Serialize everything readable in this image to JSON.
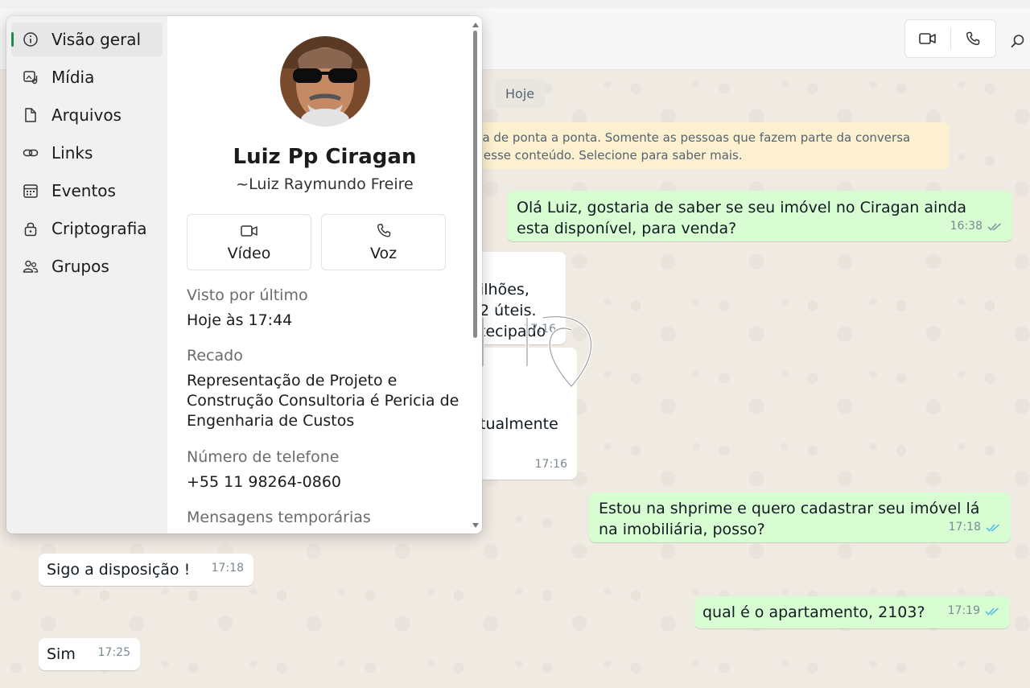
{
  "chat": {
    "date_chip": "Hoje",
    "encryption_notice": "fia de ponta a ponta. Somente as pessoas que fazem parte da conversa\nr esse conteúdo. Selecione para saber mais.",
    "messages": [
      {
        "text": "Olá Luiz, gostaria de saber se seu imóvel no Ciragan ainda esta disponível, para venda?",
        "time": "16:38"
      },
      {
        "text": "ilhões,\n2 úteis.\ntecipado",
        "time": "17:16"
      },
      {
        "text": "tualmente",
        "time": "17:16"
      },
      {
        "text": "Estou na shprime e quero cadastrar seu imóvel lá na imobiliária, posso?",
        "time": "17:18"
      },
      {
        "text": "Sigo a disposição !",
        "time": "17:18"
      },
      {
        "text": "qual é o apartamento, 2103?",
        "time": "17:19"
      },
      {
        "text": "Sim",
        "time": "17:25"
      }
    ]
  },
  "colors": {
    "read_tick": "#53bdeb",
    "delivered_tick": "#8696a0",
    "accent": "#1d8a49",
    "outgoing_bubble": "#d9fdd3",
    "notice_bg": "#fdf0d1"
  },
  "contact_panel": {
    "nav": [
      {
        "label": "Visão geral",
        "icon": "info-icon"
      },
      {
        "label": "Mídia",
        "icon": "media-icon"
      },
      {
        "label": "Arquivos",
        "icon": "file-icon"
      },
      {
        "label": "Links",
        "icon": "link-icon"
      },
      {
        "label": "Eventos",
        "icon": "calendar-icon"
      },
      {
        "label": "Criptografia",
        "icon": "lock-icon"
      },
      {
        "label": "Grupos",
        "icon": "groups-icon"
      }
    ],
    "name": "Luiz Pp Ciragan",
    "push_name": "~Luiz Raymundo Freire",
    "video_label": "Vídeo",
    "voice_label": "Voz",
    "last_seen_label": "Visto por último",
    "last_seen_value": "Hoje às 17:44",
    "about_label": "Recado",
    "about_value": "Representação de Projeto e Construção Consultoria é Pericia de Engenharia de Custos",
    "phone_label": "Número de telefone",
    "phone_value": "+55 11 98264-0860",
    "disappearing_label": "Mensagens temporárias"
  }
}
